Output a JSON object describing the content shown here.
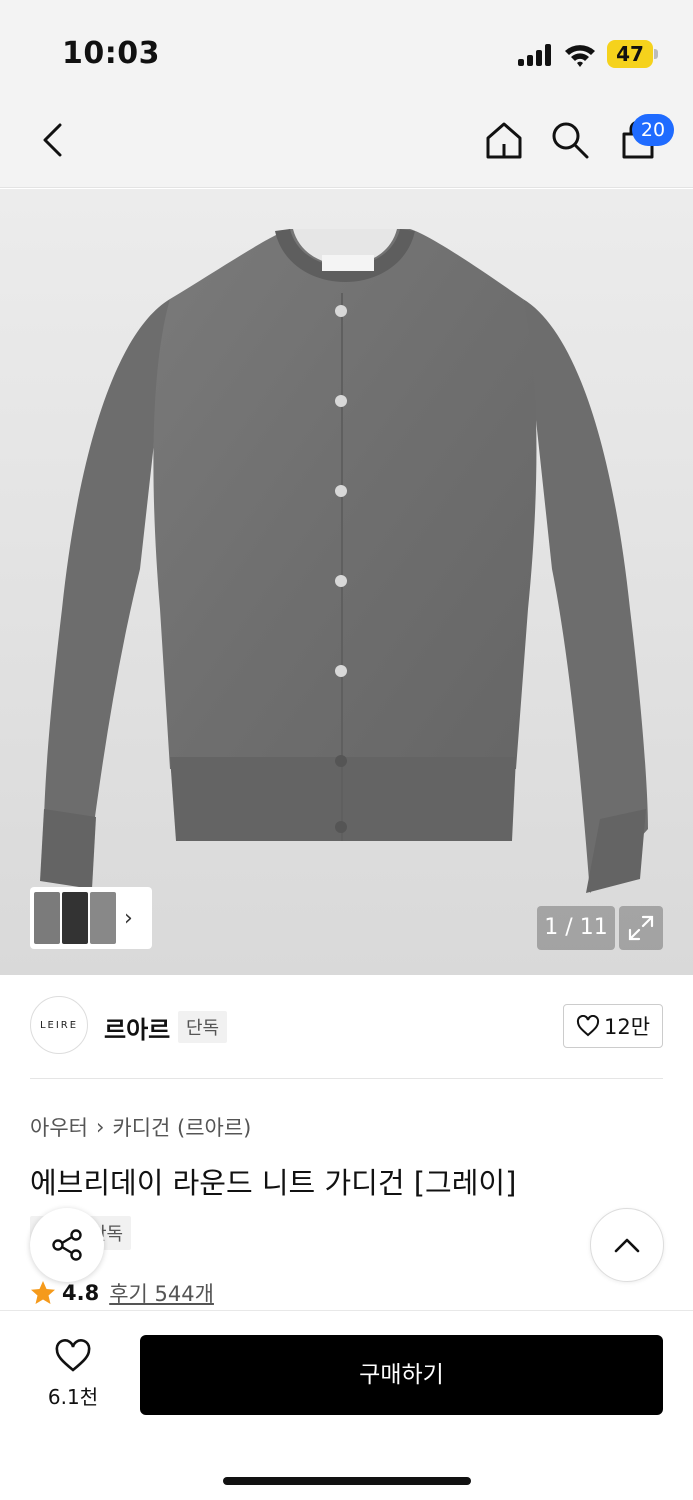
{
  "status_bar": {
    "time": "10:03",
    "battery": "47"
  },
  "header": {
    "cart_count": "20"
  },
  "gallery": {
    "page_indicator": "1 / 11",
    "current_page": 1,
    "total_pages": 11
  },
  "brand": {
    "logo_text": "LEIRE",
    "name": "르아르",
    "tag": "단독",
    "likes": "12만"
  },
  "product": {
    "breadcrumb": [
      "아우터",
      "카디건 (르아르)"
    ],
    "title": "에브리데이 라운드 니트 가디건 [그레이]",
    "tag": "단독",
    "rating": "4.8",
    "reviews": "후기 544개"
  },
  "bottom_bar": {
    "wish_count": "6.1천",
    "buy_label": "구매하기"
  },
  "colors": {
    "accent": "#1f6bff",
    "star": "#f59a1b",
    "buy_bg": "#000000",
    "battery": "#f5d21c"
  }
}
